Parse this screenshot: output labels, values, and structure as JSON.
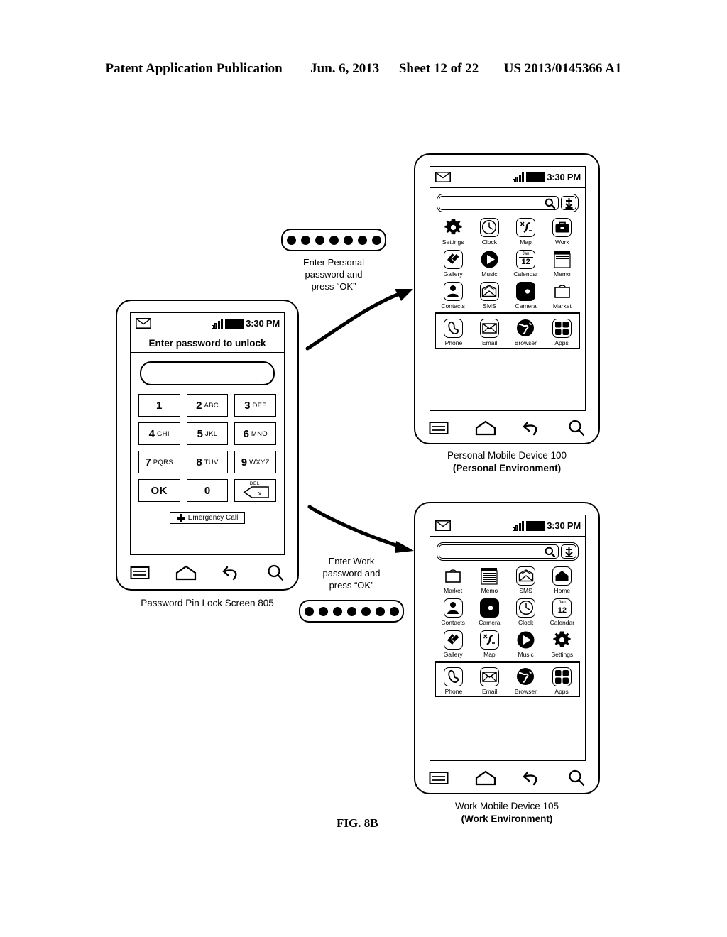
{
  "header": {
    "publication": "Patent Application Publication",
    "date": "Jun. 6, 2013",
    "sheet": "Sheet 12 of 22",
    "number": "US 2013/0145366 A1"
  },
  "figure_label": "FIG. 8B",
  "lock_device": {
    "status_bar": {
      "time": "3:30 PM",
      "mail_icon": "envelope-icon",
      "signal_icon": "signal-bars-icon",
      "battery_icon": "battery-icon"
    },
    "title": "Enter password to unlock",
    "password_field_value": "",
    "keys": [
      {
        "num": "1",
        "alpha": ""
      },
      {
        "num": "2",
        "alpha": "ABC"
      },
      {
        "num": "3",
        "alpha": "DEF"
      },
      {
        "num": "4",
        "alpha": "GHI"
      },
      {
        "num": "5",
        "alpha": "JKL"
      },
      {
        "num": "6",
        "alpha": "MNO"
      },
      {
        "num": "7",
        "alpha": "PQRS"
      },
      {
        "num": "8",
        "alpha": "TUV"
      },
      {
        "num": "9",
        "alpha": "WXYZ"
      },
      {
        "num": "OK",
        "alpha": ""
      },
      {
        "num": "0",
        "alpha": ""
      },
      {
        "num": "DEL",
        "alpha": ""
      }
    ],
    "del_label": "DEL",
    "del_glyph": "x",
    "emergency_call": "Emergency Call",
    "nav": [
      "menu-icon",
      "home-icon",
      "back-icon",
      "search-icon"
    ],
    "caption": "Password Pin Lock Screen 805"
  },
  "personal_device": {
    "status_bar": {
      "time": "3:30 PM"
    },
    "search": {
      "placeholder": "",
      "value": "",
      "search_icon": "search-icon",
      "voice_icon": "mic-icon"
    },
    "apps": [
      {
        "label": "Settings",
        "icon": "gear-icon"
      },
      {
        "label": "Clock",
        "icon": "clock-icon"
      },
      {
        "label": "Map",
        "icon": "map-icon"
      },
      {
        "label": "Work",
        "icon": "briefcase-icon"
      },
      {
        "label": "Gallery",
        "icon": "gallery-icon"
      },
      {
        "label": "Music",
        "icon": "play-icon"
      },
      {
        "label": "Calendar",
        "icon": "calendar-icon"
      },
      {
        "label": "Memo",
        "icon": "memo-icon"
      },
      {
        "label": "Contacts",
        "icon": "contact-icon"
      },
      {
        "label": "SMS",
        "icon": "envelope-open-icon"
      },
      {
        "label": "Camera",
        "icon": "camera-icon"
      },
      {
        "label": "Market",
        "icon": "bag-icon"
      }
    ],
    "dock": [
      {
        "label": "Phone",
        "icon": "phone-icon"
      },
      {
        "label": "Email",
        "icon": "envelope-icon"
      },
      {
        "label": "Browser",
        "icon": "globe-icon"
      },
      {
        "label": "Apps",
        "icon": "grid-icon"
      }
    ],
    "calendar_month": "Jan",
    "calendar_day": "12",
    "nav": [
      "menu-icon",
      "home-icon",
      "back-icon",
      "search-icon"
    ],
    "caption_line1": "Personal Mobile Device 100",
    "caption_line2": "(Personal Environment)"
  },
  "work_device": {
    "status_bar": {
      "time": "3:30 PM"
    },
    "search": {
      "placeholder": "",
      "value": "",
      "search_icon": "search-icon",
      "voice_icon": "mic-icon"
    },
    "apps": [
      {
        "label": "Market",
        "icon": "bag-icon"
      },
      {
        "label": "Memo",
        "icon": "memo-icon"
      },
      {
        "label": "SMS",
        "icon": "envelope-open-icon"
      },
      {
        "label": "Home",
        "icon": "house-icon"
      },
      {
        "label": "Contacts",
        "icon": "contact-icon"
      },
      {
        "label": "Camera",
        "icon": "camera-icon"
      },
      {
        "label": "Clock",
        "icon": "clock-icon"
      },
      {
        "label": "Calendar",
        "icon": "calendar-icon"
      },
      {
        "label": "Gallery",
        "icon": "gallery-icon"
      },
      {
        "label": "Map",
        "icon": "map-icon"
      },
      {
        "label": "Music",
        "icon": "play-icon"
      },
      {
        "label": "Settings",
        "icon": "gear-icon"
      }
    ],
    "dock": [
      {
        "label": "Phone",
        "icon": "phone-icon"
      },
      {
        "label": "Email",
        "icon": "envelope-icon"
      },
      {
        "label": "Browser",
        "icon": "globe-icon"
      },
      {
        "label": "Apps",
        "icon": "grid-icon"
      }
    ],
    "calendar_month": "Jan",
    "calendar_day": "12",
    "nav": [
      "menu-icon",
      "home-icon",
      "back-icon",
      "search-icon"
    ],
    "caption_line1": "Work Mobile Device 105",
    "caption_line2": "(Work Environment)"
  },
  "personal_callout": {
    "dots": 7,
    "line1": "Enter Personal",
    "line2": "password and",
    "line3": "press “OK”"
  },
  "work_callout": {
    "dots": 7,
    "line1": "Enter Work",
    "line2": "password and",
    "line3": "press “OK”"
  }
}
